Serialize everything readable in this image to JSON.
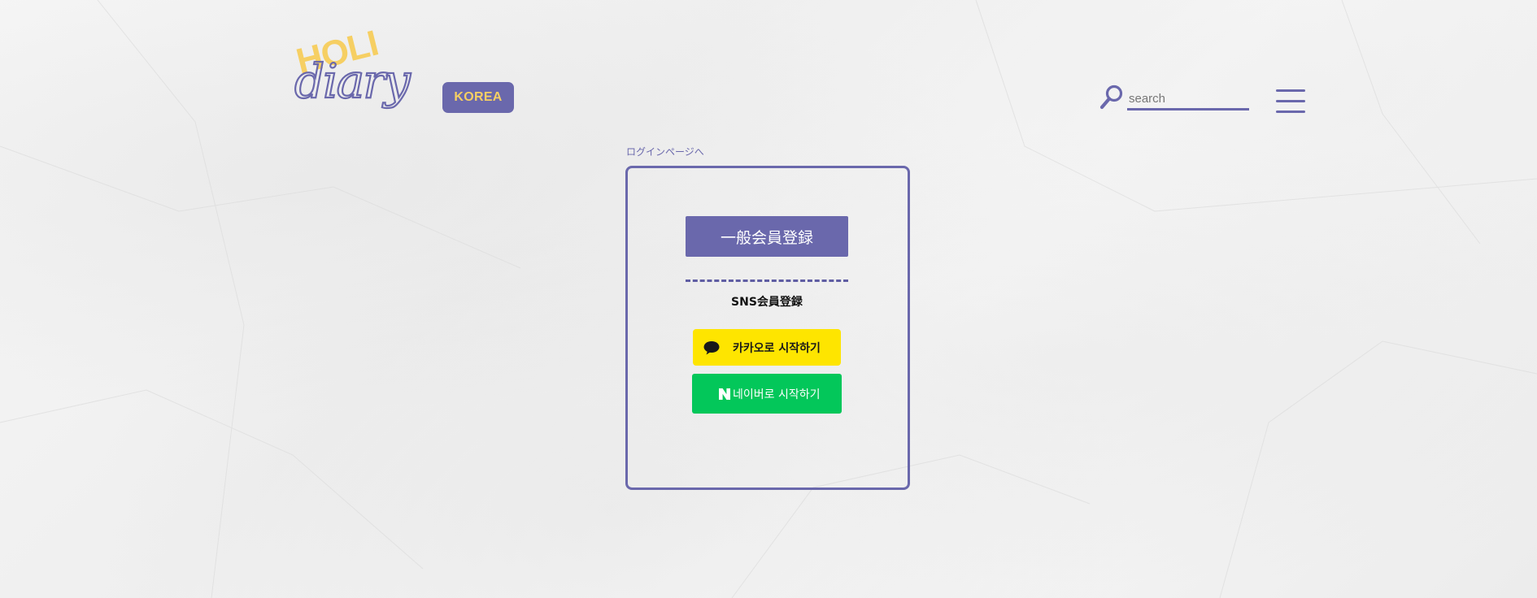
{
  "colors": {
    "brand_purple": "#6a68ac",
    "brand_yellow": "#f6cf63",
    "kakao_yellow": "#fee500",
    "naver_green": "#03c75a"
  },
  "header": {
    "logo": {
      "line1": "HOLI",
      "line2": "diary"
    },
    "country_badge": "KOREA",
    "search": {
      "placeholder": "search",
      "icon": "search-icon"
    },
    "menu_icon": "hamburger-menu-icon"
  },
  "breadcrumb": {
    "login_link": "ログインページへ"
  },
  "signup_card": {
    "general_signup_label": "一般会員登録",
    "sns_signup_label": "SNS会員登録",
    "kakao_button": {
      "label": "카카오로 시작하기",
      "icon": "kakao-chat-icon"
    },
    "naver_button": {
      "label": "네이버로 시작하기",
      "icon": "naver-n-icon"
    }
  }
}
